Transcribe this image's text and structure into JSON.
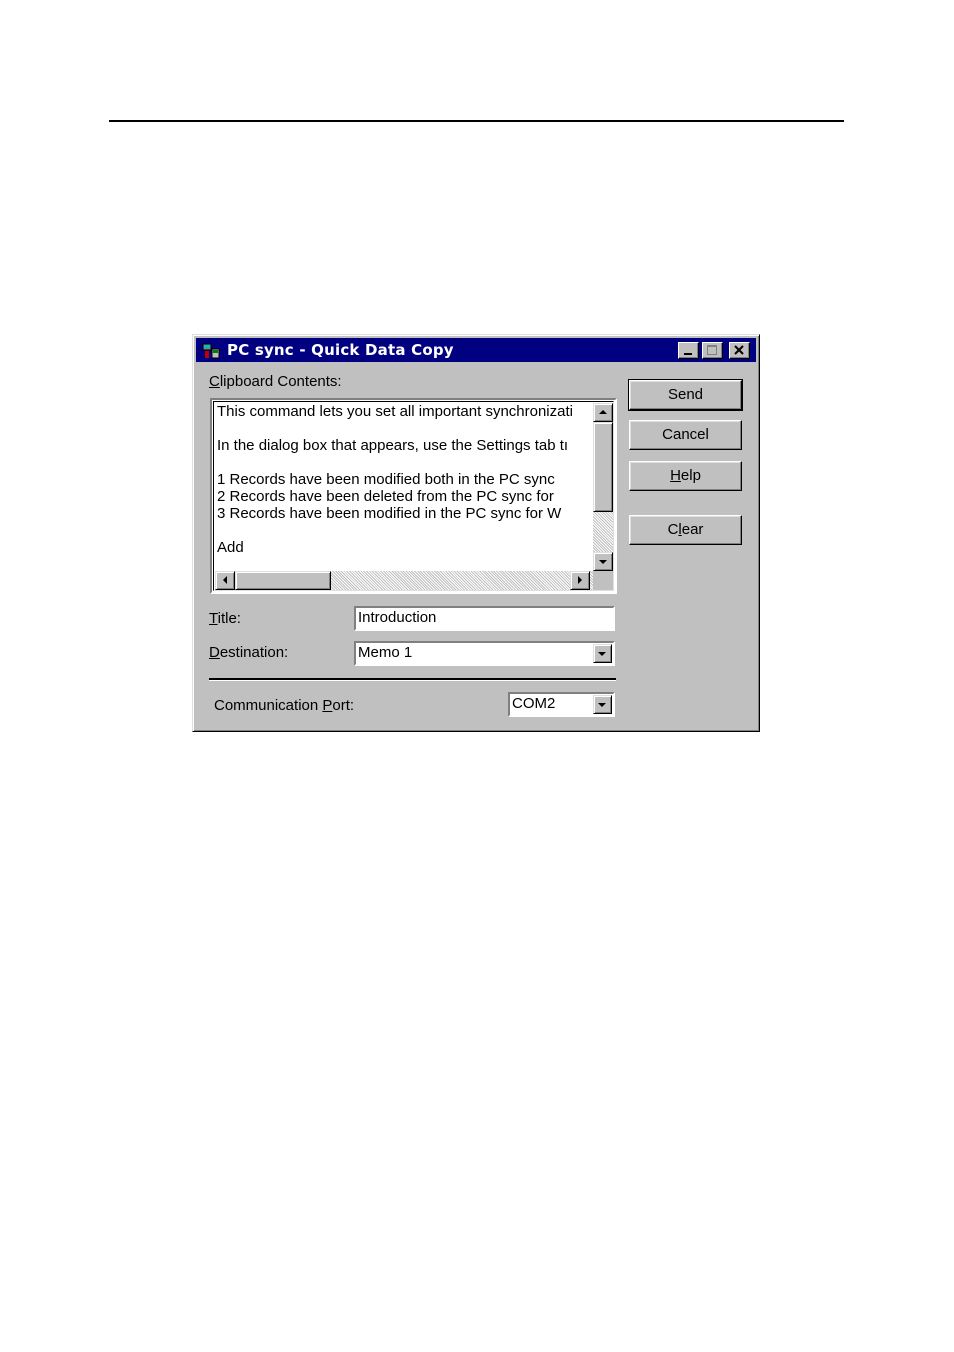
{
  "window": {
    "title": "PC sync - Quick Data Copy"
  },
  "clipboard": {
    "label_prefix": "",
    "label_mnemonic": "C",
    "label_rest": "lipboard Contents:",
    "lines": [
      "This command lets you set all important synchronizati",
      "In the dialog box that appears, use the Settings tab tı",
      "1   Records have been modified both in the PC sync",
      "2   Records have been deleted from the PC sync for",
      "3   Records have been modified in the PC sync for W",
      "Add"
    ]
  },
  "buttons": {
    "send": "Send",
    "cancel": "Cancel",
    "help_mnemonic": "H",
    "help_rest": "elp",
    "clear_prefix": "C",
    "clear_mnemonic": "l",
    "clear_rest": "ear"
  },
  "form": {
    "title_label_mnemonic": "T",
    "title_label_rest": "itle:",
    "title_value": "Introduction",
    "destination_label_mnemonic": "D",
    "destination_label_rest": "estination:",
    "destination_value": "Memo 1",
    "port_label_prefix": "Communication ",
    "port_label_mnemonic": "P",
    "port_label_rest": "ort:",
    "port_value": "COM2"
  },
  "icons": {
    "app": "app-icon",
    "minimize": "minimize-icon",
    "maximize": "maximize-icon",
    "close": "close-icon",
    "scroll_up": "arrow-up-icon",
    "scroll_down": "arrow-down-icon",
    "scroll_left": "arrow-left-icon",
    "scroll_right": "arrow-right-icon",
    "dropdown": "chevron-down-icon"
  },
  "colors": {
    "titlebar": "#000080",
    "face": "#c0c0c0"
  }
}
